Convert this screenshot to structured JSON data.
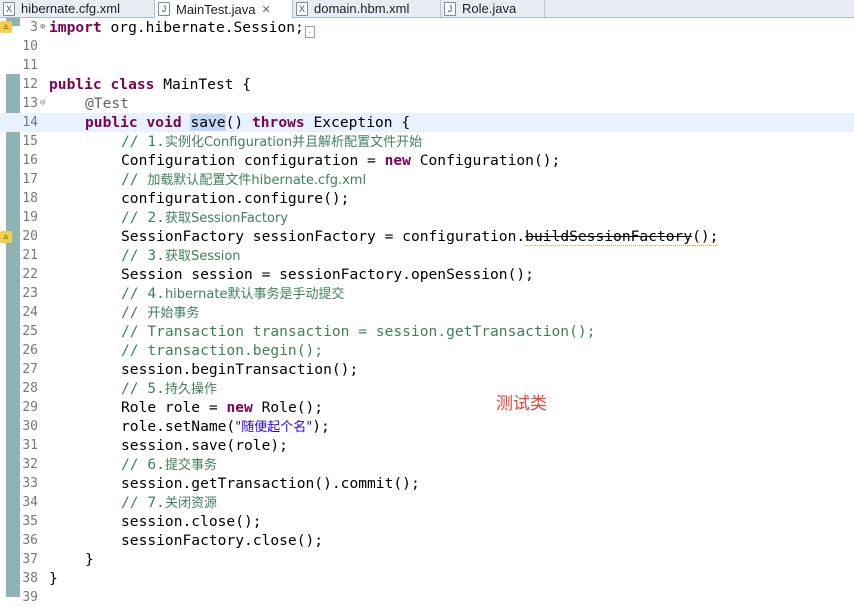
{
  "tabs": [
    {
      "label": "hibernate.cfg.xml",
      "icon": "xml-file-icon",
      "active": false
    },
    {
      "label": "MainTest.java",
      "icon": "java-file-icon",
      "active": true
    },
    {
      "label": "domain.hbm.xml",
      "icon": "xml-file-icon",
      "active": false
    },
    {
      "label": "Role.java",
      "icon": "java-file-icon",
      "active": false
    }
  ],
  "tab_icon_glyphs": {
    "xml": "X",
    "java": "J"
  },
  "close_glyph": "✕",
  "editor": {
    "line_numbers": [
      "3",
      "10",
      "11",
      "12",
      "13",
      "14",
      "15",
      "16",
      "17",
      "18",
      "19",
      "20",
      "21",
      "22",
      "23",
      "24",
      "25",
      "26",
      "27",
      "28",
      "29",
      "30",
      "31",
      "32",
      "33",
      "34",
      "35",
      "36",
      "37",
      "38",
      "39"
    ],
    "import_kw": "import",
    "import_pkg": " org.hibernate.Session;",
    "class_kw": "public class",
    "class_rest": " MainTest {",
    "annotation": "@Test",
    "method_kw1": "public void",
    "method_name": "save",
    "method_mid": "() ",
    "method_kw2": "throws",
    "method_rest": " Exception {",
    "c1_prefix": "// 1.",
    "c1_text": "实例化Configuration并且解析配置文件开始",
    "s1_type": "Configuration configuration = ",
    "s1_new": "new",
    "s1_rest": " Configuration();",
    "c2_prefix": "// ",
    "c2_text": "加载默认配置文件hibernate.cfg.xml",
    "s2": "configuration.configure();",
    "c3_prefix": "// 2.",
    "c3_text": "获取SessionFactory",
    "s3_a": "SessionFactory sessionFactory = configuration.",
    "s3_b": "buildSessionFactory",
    "s3_c": "();",
    "c4_prefix": "// 3.",
    "c4_text": "获取Session",
    "s4": "Session session = sessionFactory.openSession();",
    "c5_prefix": "// 4.",
    "c5_text": "hibernate默认事务是手动提交",
    "c6_prefix": "// ",
    "c6_text": "开始事务",
    "c7": "// Transaction transaction = session.getTransaction();",
    "c8": "// transaction.begin();",
    "s5": "session.beginTransaction();",
    "c9_prefix": "// 5.",
    "c9_text": "持久操作",
    "s6_a": "Role role = ",
    "s6_new": "new",
    "s6_b": " Role();",
    "s7_a": "role.setName(",
    "s7_str": "\"随便起个名\"",
    "s7_b": ");",
    "s8": "session.save(role);",
    "c10_prefix": "// 6.",
    "c10_text": "提交事务",
    "s9": "session.getTransaction().commit();",
    "c11_prefix": "// 7.",
    "c11_text": "关闭资源",
    "s10": "session.close();",
    "s11": "sessionFactory.close();",
    "close_method": "}",
    "close_class": "}"
  },
  "annotation_note": "测试类",
  "colors": {
    "keyword": "#7f0055",
    "comment": "#3f7f5f",
    "string": "#2a00ff",
    "annotation": "#646464",
    "note": "#e0443a"
  }
}
